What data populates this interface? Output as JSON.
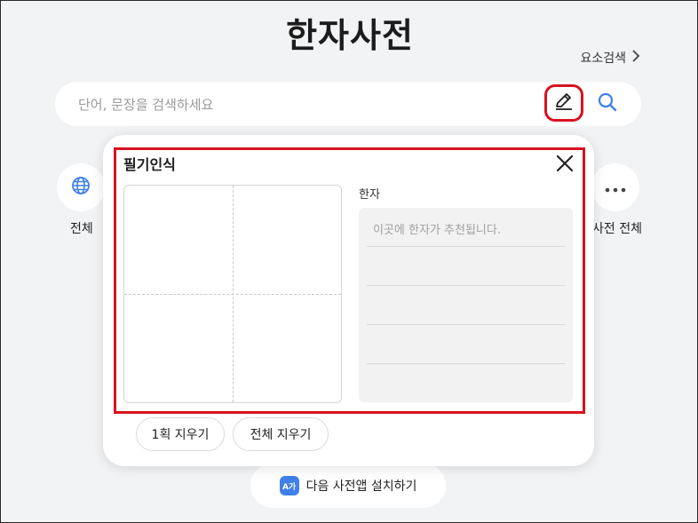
{
  "header": {
    "title": "한자사전",
    "element_search": "요소검색"
  },
  "search": {
    "placeholder": "단어, 문장을 검색하세요",
    "value": ""
  },
  "categories": [
    {
      "label": "전체",
      "icon": "globe-icon"
    },
    {
      "label": "사전 전체",
      "icon": "more-dots-icon"
    }
  ],
  "handwriting": {
    "title": "필기인식",
    "hanja_label": "한자",
    "hanja_placeholder": "이곳에 한자가 추천됩니다.",
    "erase_one_label": "1획 지우기",
    "erase_all_label": "전체 지우기"
  },
  "app_banner": {
    "badge": "A가",
    "label": "다음 사전앱 설치하기"
  },
  "colors": {
    "highlight": "#d8121f",
    "accent_blue": "#3f7fea",
    "background": "#f2f3f5"
  }
}
